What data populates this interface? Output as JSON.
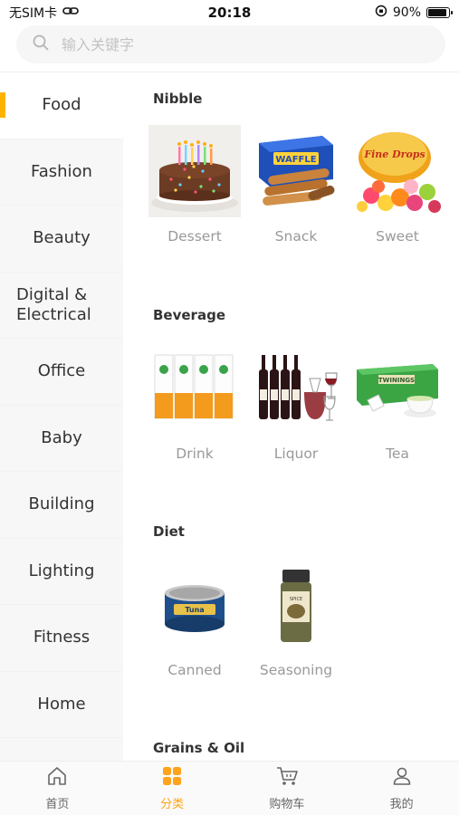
{
  "status": {
    "carrier": "无SIM卡",
    "time": "20:18",
    "battery_percent": "90%",
    "battery_level": 0.9
  },
  "search": {
    "placeholder": "输入关键字"
  },
  "sidebar": {
    "items": [
      {
        "label": "Food",
        "active": true
      },
      {
        "label": "Fashion"
      },
      {
        "label": "Beauty"
      },
      {
        "label": "Digital &\nElectrical"
      },
      {
        "label": "Office"
      },
      {
        "label": "Baby"
      },
      {
        "label": "Building"
      },
      {
        "label": "Lighting"
      },
      {
        "label": "Fitness"
      },
      {
        "label": "Home"
      }
    ]
  },
  "sections": [
    {
      "title": "Nibble",
      "items": [
        {
          "label": "Dessert",
          "icon": "cake-image"
        },
        {
          "label": "Snack",
          "icon": "waffle-box-image"
        },
        {
          "label": "Sweet",
          "icon": "candy-tin-image"
        }
      ]
    },
    {
      "title": "Beverage",
      "items": [
        {
          "label": "Drink",
          "icon": "juice-cartons-image"
        },
        {
          "label": "Liquor",
          "icon": "wine-bottles-image"
        },
        {
          "label": "Tea",
          "icon": "tea-box-image"
        }
      ]
    },
    {
      "title": "Diet",
      "items": [
        {
          "label": "Canned",
          "icon": "tuna-can-image"
        },
        {
          "label": "Seasoning",
          "icon": "spice-jar-image"
        }
      ]
    },
    {
      "title": "Grains & Oil",
      "items": []
    }
  ],
  "tabbar": {
    "items": [
      {
        "label": "首页",
        "icon": "home-icon"
      },
      {
        "label": "分类",
        "icon": "category-grid-icon",
        "active": true
      },
      {
        "label": "购物车",
        "icon": "cart-icon"
      },
      {
        "label": "我的",
        "icon": "profile-icon"
      }
    ]
  },
  "colors": {
    "accent": "#ffa31a",
    "sidebar_bg": "#f7f7f7",
    "indicator": "#ffb300"
  }
}
